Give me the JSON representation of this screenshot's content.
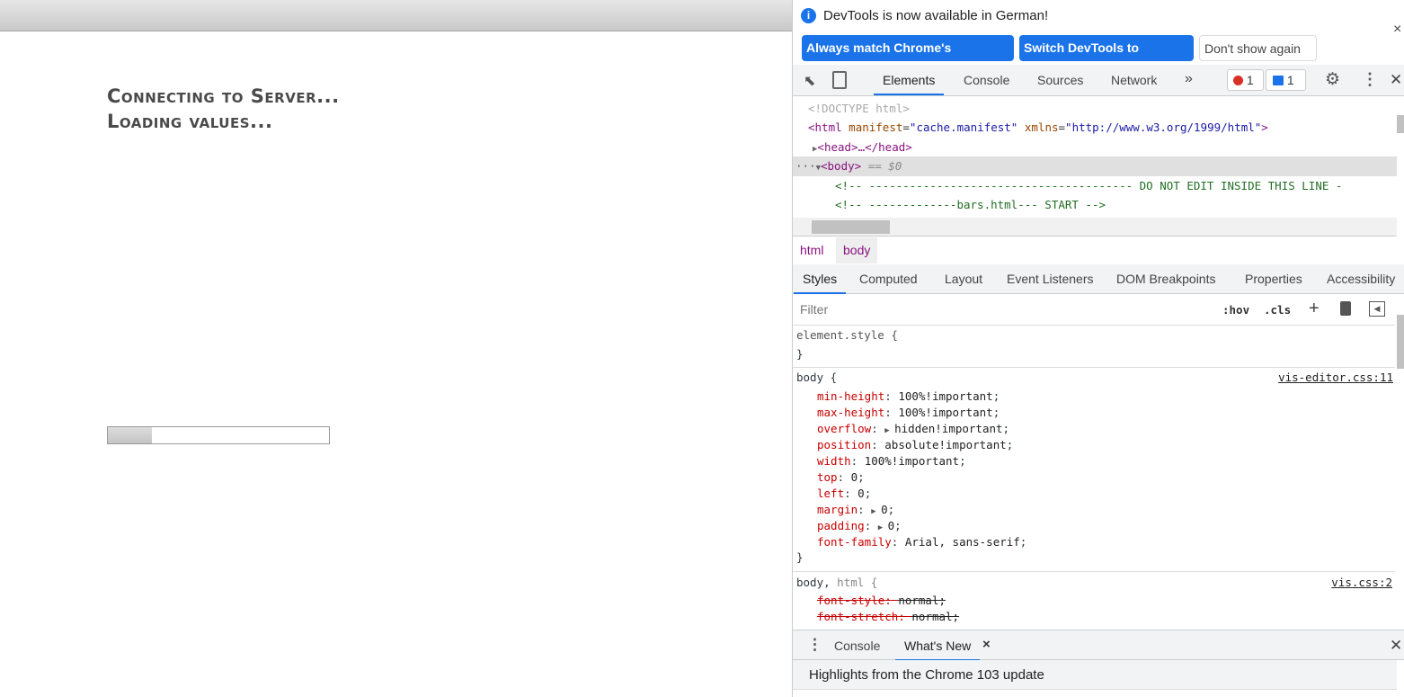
{
  "page": {
    "status_lines": [
      "Connecting to Server...",
      "Loading values..."
    ],
    "progress_percent": 20
  },
  "devtools": {
    "infobar": {
      "message": "DevTools is now available in German!",
      "buttons": [
        "Always match Chrome's language",
        "Switch DevTools to German",
        "Don't show again"
      ],
      "close": "×"
    },
    "main_tabs": [
      "Elements",
      "Console",
      "Sources",
      "Network"
    ],
    "more_tabs": "»",
    "error_count": "1",
    "message_count": "1",
    "close": "✕",
    "dom": {
      "doctype": "<!DOCTYPE html>",
      "html_open": "<html",
      "manifest_attr": "manifest",
      "manifest_val": "\"cache.manifest\"",
      "xmlns_attr": "xmlns",
      "xmlns_val": "\"http://www.w3.org/1999/html\"",
      "close_bracket": ">",
      "head": "<head>…</head>",
      "body": "<body>",
      "body_ref": "== $0",
      "comment1": "<!-- ---------------------------------------  DO NOT EDIT INSIDE THIS LINE -",
      "comment2": "<!-- -------------bars.html--- START -->"
    },
    "breadcrumbs": [
      "html",
      "body"
    ],
    "style_tabs": [
      "Styles",
      "Computed",
      "Layout",
      "Event Listeners",
      "DOM Breakpoints",
      "Properties",
      "Accessibility"
    ],
    "filter_placeholder": "Filter",
    "hov": ":hov",
    "cls": ".cls",
    "element_style": "element.style {",
    "close_brace": "}",
    "body_rule": {
      "selector": "body {",
      "source": "vis-editor.css:11",
      "props": [
        [
          "min-height",
          "100%!important"
        ],
        [
          "max-height",
          "100%!important"
        ],
        [
          "overflow",
          "hidden!important"
        ],
        [
          "position",
          "absolute!important"
        ],
        [
          "width",
          "100%!important"
        ],
        [
          "top",
          "0"
        ],
        [
          "left",
          "0"
        ],
        [
          "margin",
          "0"
        ],
        [
          "padding",
          "0"
        ],
        [
          "font-family",
          "Arial, sans-serif"
        ]
      ]
    },
    "body_html_rule": {
      "selector": "body,",
      "selector2": "html {",
      "source": "vis.css:2",
      "props": [
        [
          "font-style",
          "normal"
        ],
        [
          "font-stretch",
          "normal"
        ]
      ]
    },
    "drawer": {
      "tabs": [
        "Console",
        "What's New"
      ],
      "tab_close": "×",
      "close": "✕",
      "headline": "Highlights from the Chrome 103 update"
    }
  },
  "colors": {
    "accent": "#1a73e8",
    "error": "#d93025"
  }
}
